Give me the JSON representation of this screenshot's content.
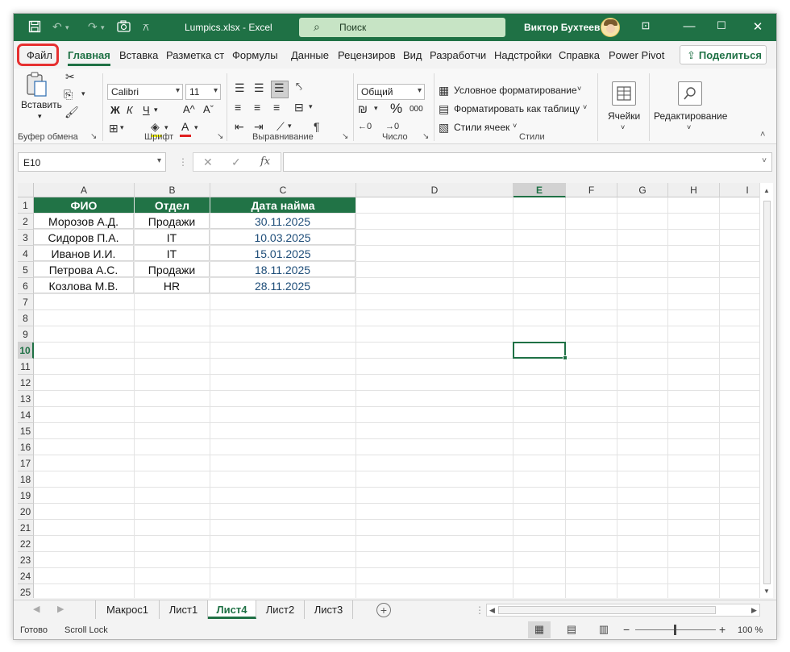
{
  "titlebar": {
    "filename": "Lumpics.xlsx",
    "app": "Excel",
    "title_sep": " - ",
    "search_placeholder": "Поиск",
    "user": "Виктор Бухтеев",
    "accent": "#1f7145"
  },
  "ribbon_tabs": [
    {
      "label": "Файл",
      "active": false,
      "highlighted": true
    },
    {
      "label": "Главная",
      "active": true
    },
    {
      "label": "Вставка"
    },
    {
      "label": "Разметка ст"
    },
    {
      "label": "Формулы"
    },
    {
      "label": "Данные"
    },
    {
      "label": "Рецензиров"
    },
    {
      "label": "Вид"
    },
    {
      "label": "Разработчи"
    },
    {
      "label": "Надстройки"
    },
    {
      "label": "Справка"
    },
    {
      "label": "Power Pivot"
    }
  ],
  "share_label": "Поделиться",
  "ribbon": {
    "clipboard": {
      "paste": "Вставить",
      "label": "Буфер обмена"
    },
    "font": {
      "name": "Calibri",
      "size": "11",
      "bold": "Ж",
      "italic": "К",
      "underline": "Ч",
      "grow": "A^",
      "shrink": "Aˇ",
      "label": "Шрифт"
    },
    "alignment": {
      "label": "Выравнивание"
    },
    "number": {
      "format": "Общий",
      "percent": "%",
      "thousands": "000",
      "label": "Число"
    },
    "styles": {
      "conditional": "Условное форматирование",
      "as_table": "Форматировать как таблицу",
      "cell_styles": "Стили ячеек",
      "label": "Стили"
    },
    "cells": {
      "label": "Ячейки"
    },
    "editing": {
      "label": "Редактирование"
    }
  },
  "formula_bar": {
    "name_box": "E10",
    "cancel": "✕",
    "confirm": "✓",
    "fx": "fx",
    "formula": ""
  },
  "sheet": {
    "columns": [
      "A",
      "B",
      "C",
      "D",
      "E",
      "F",
      "G",
      "H",
      "I"
    ],
    "rows": [
      "1",
      "2",
      "3",
      "4",
      "5",
      "6",
      "7",
      "8",
      "9",
      "10",
      "11",
      "12",
      "13",
      "14",
      "15",
      "16",
      "17",
      "18",
      "19",
      "20",
      "21",
      "22",
      "23",
      "24",
      "25"
    ],
    "selected_column": "E",
    "selected_row": "10",
    "headers": [
      "ФИО",
      "Отдел",
      "Дата найма"
    ],
    "data": [
      [
        "Морозов А.Д.",
        "Продажи",
        "30.11.2025"
      ],
      [
        "Сидоров П.А.",
        "IT",
        "10.03.2025"
      ],
      [
        "Иванов И.И.",
        "IT",
        "15.01.2025"
      ],
      [
        "Петрова А.С.",
        "Продажи",
        "18.11.2025"
      ],
      [
        "Козлова М.В.",
        "HR",
        "28.11.2025"
      ]
    ],
    "header_color": "#217346",
    "date_color": "#1f4e79"
  },
  "sheet_tabs": [
    {
      "label": "Макрос1",
      "active": false
    },
    {
      "label": "Лист1",
      "active": false
    },
    {
      "label": "Лист4",
      "active": true
    },
    {
      "label": "Лист2",
      "active": false
    },
    {
      "label": "Лист3",
      "active": false
    }
  ],
  "status": {
    "ready": "Готово",
    "scroll_lock": "Scroll Lock",
    "zoom_minus": "−",
    "zoom_plus": "+",
    "zoom": "100 %"
  }
}
